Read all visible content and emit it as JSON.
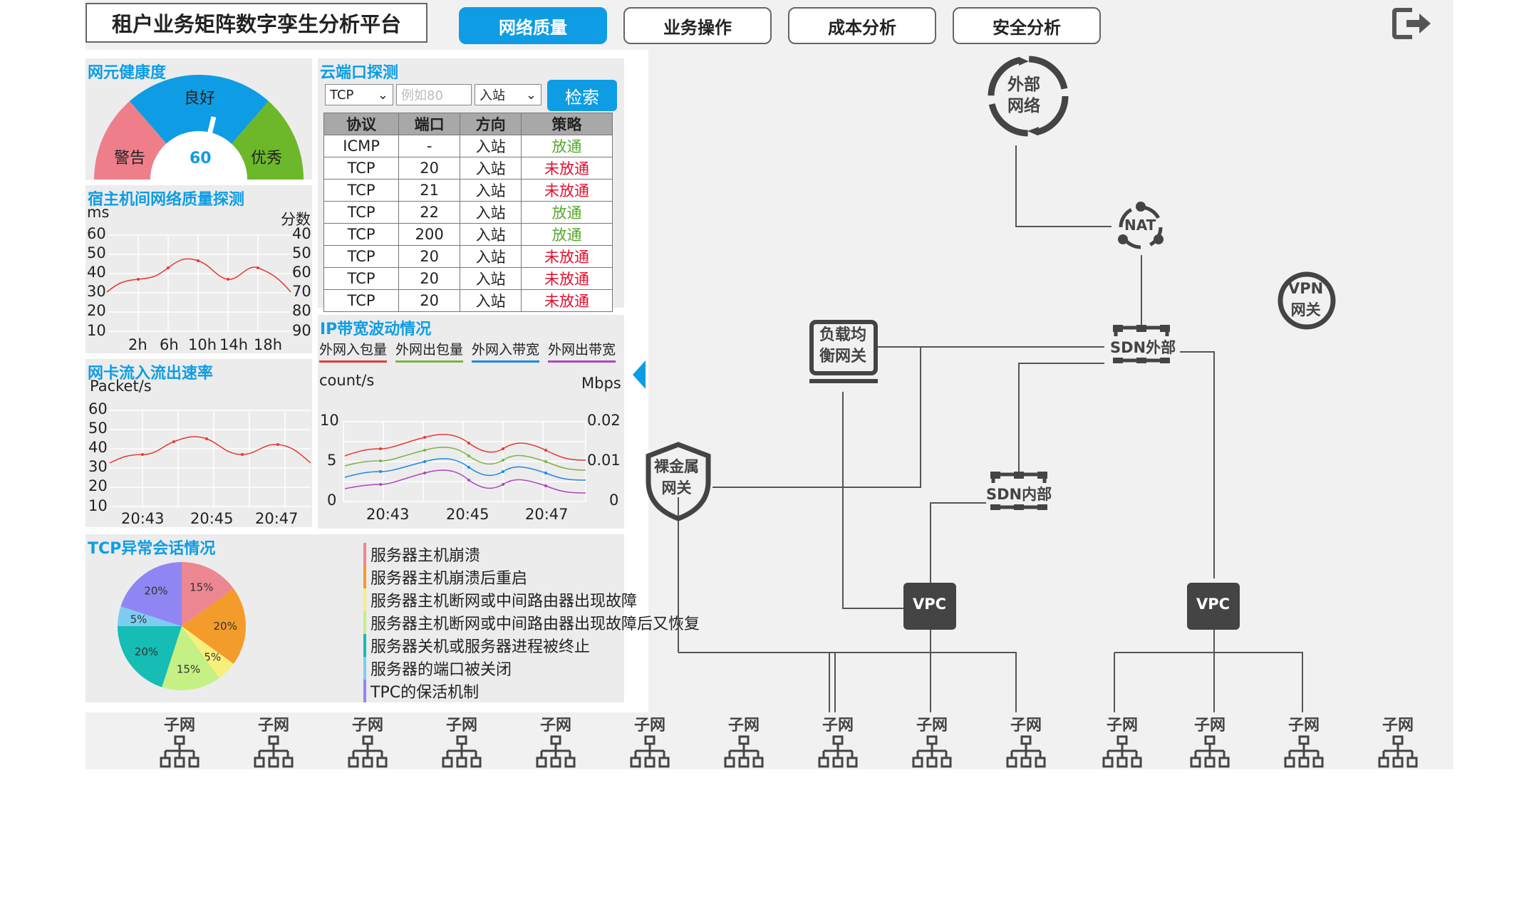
{
  "app": {
    "title": "租户业务矩阵数字孪生分析平台"
  },
  "nav": {
    "tabs": [
      {
        "label": "网络质量",
        "active": true
      },
      {
        "label": "业务操作",
        "active": false
      },
      {
        "label": "成本分析",
        "active": false
      },
      {
        "label": "安全分析",
        "active": false
      }
    ]
  },
  "health": {
    "title": "网元健康度",
    "value": "60",
    "labels": {
      "good": "良好",
      "warn": "警告",
      "excellent": "优秀"
    }
  },
  "host_probe": {
    "title": "宿主机间网络质量探测",
    "y_left_unit": "ms",
    "y_right_unit": "分数",
    "y_left_ticks": [
      "60",
      "50",
      "40",
      "30",
      "20",
      "10"
    ],
    "y_right_ticks": [
      "40",
      "50",
      "60",
      "70",
      "80",
      "90"
    ],
    "x_ticks": [
      "2h",
      "6h",
      "10h",
      "14h",
      "18h"
    ]
  },
  "nic_rate": {
    "title": "网卡流入流出速率",
    "unit": "Packet/s",
    "y_ticks": [
      "60",
      "50",
      "40",
      "30",
      "20",
      "10"
    ],
    "x_ticks": [
      "20:43",
      "20:45",
      "20:47"
    ]
  },
  "port_probe": {
    "title": "云端口探测",
    "protocol": "TCP",
    "port_placeholder": "例如80",
    "direction": "入站",
    "search_label": "检索",
    "columns": [
      "协议",
      "端口",
      "方向",
      "策略"
    ],
    "rows": [
      [
        "ICMP",
        "-",
        "入站",
        "放通"
      ],
      [
        "TCP",
        "20",
        "入站",
        "未放通"
      ],
      [
        "TCP",
        "21",
        "入站",
        "未放通"
      ],
      [
        "TCP",
        "22",
        "入站",
        "放通"
      ],
      [
        "TCP",
        "200",
        "入站",
        "放通"
      ],
      [
        "TCP",
        "20",
        "入站",
        "未放通"
      ],
      [
        "TCP",
        "20",
        "入站",
        "未放通"
      ],
      [
        "TCP",
        "20",
        "入站",
        "未放通"
      ]
    ]
  },
  "bandwidth": {
    "title": "IP带宽波动情况",
    "legend": [
      {
        "label": "外网入包量",
        "color": "#e53935"
      },
      {
        "label": "外网出包量",
        "color": "#7cb342"
      },
      {
        "label": "外网入带宽",
        "color": "#1e88e5"
      },
      {
        "label": "外网出带宽",
        "color": "#ab47bc"
      }
    ],
    "y_left_unit": "count/s",
    "y_right_unit": "Mbps",
    "y_left_ticks": [
      "10",
      "5",
      "0"
    ],
    "y_right_ticks": [
      "0.02",
      "0.01",
      "0"
    ],
    "x_ticks": [
      "20:43",
      "20:45",
      "20:47"
    ]
  },
  "tcp_sessions": {
    "title": "TCP异常会话情况",
    "slices": [
      {
        "label": "服务器主机崩溃",
        "value": 15,
        "text": "15%",
        "color": "#ec8792"
      },
      {
        "label": "服务器主机崩溃后重启",
        "value": 20,
        "text": "20%",
        "color": "#f39b2b"
      },
      {
        "label": "服务器主机断网或中间路由器出现故障",
        "value": 5,
        "text": "5%",
        "color": "#f7ef7a"
      },
      {
        "label": "服务器主机断网或中间路由器出现故障后又恢复",
        "value": 15,
        "text": "15%",
        "color": "#c5f083"
      },
      {
        "label": "服务器关机或服务器进程被终止",
        "value": 20,
        "text": "20%",
        "color": "#15bdb5"
      },
      {
        "label": "服务器的端口被关闭",
        "value": 5,
        "text": "5%",
        "color": "#7ecdf0"
      },
      {
        "label": "TPC的保活机制",
        "value": 20,
        "text": "20%",
        "color": "#8f86f4"
      }
    ]
  },
  "topology": {
    "external": "外部网络",
    "external_l1": "外部",
    "external_l2": "网络",
    "nat": "NAT",
    "vpn_l1": "VPN",
    "vpn_l2": "网关",
    "lb_l1": "负载均",
    "lb_l2": "衡网关",
    "sdn_ext": "SDN外部",
    "sdn_int": "SDN内部",
    "bm_l1": "裸金属",
    "bm_l2": "网关",
    "vpc1": "VPC",
    "vpc2": "VPC",
    "subnet_label": "子网",
    "subnets": [
      "子网",
      "子网",
      "子网",
      "子网",
      "子网",
      "子网",
      "子网",
      "子网",
      "子网",
      "子网",
      "子网",
      "子网",
      "子网",
      "子网"
    ]
  }
}
